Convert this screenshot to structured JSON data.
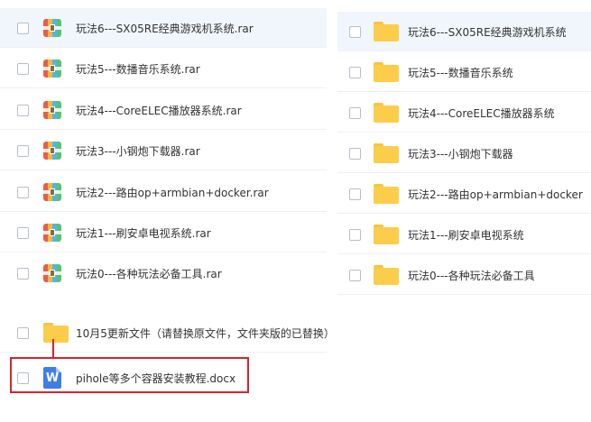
{
  "left_panel": {
    "rows": [
      {
        "name": "玩法6---SX05RE经典游戏机系统.rar",
        "icon": "rar-archive-icon",
        "selected": true
      },
      {
        "name": "玩法5---数播音乐系统.rar",
        "icon": "rar-archive-icon"
      },
      {
        "name": "玩法4---CoreELEC播放器系统.rar",
        "icon": "rar-archive-icon"
      },
      {
        "name": "玩法3---小钢炮下载器.rar",
        "icon": "rar-archive-icon"
      },
      {
        "name": "玩法2---路由op+armbian+docker.rar",
        "icon": "rar-archive-icon"
      },
      {
        "name": "玩法1---刷安卓电视系统.rar",
        "icon": "rar-archive-icon"
      },
      {
        "name": "玩法0---各种玩法必备工具.rar",
        "icon": "rar-archive-icon"
      }
    ],
    "folder_row": {
      "name": "10月5更新文件（请替换原文件，文件夹版的已替换）",
      "icon": "folder-icon"
    },
    "doc_row": {
      "name": "pihole等多个容器安装教程.docx",
      "icon": "word-doc-icon",
      "icon_letter": "W"
    }
  },
  "right_panel": {
    "rows": [
      {
        "name": "玩法6---SX05RE经典游戏机系统",
        "icon": "folder-icon",
        "selected": true
      },
      {
        "name": "玩法5---数播音乐系统",
        "icon": "folder-icon"
      },
      {
        "name": "玩法4---CoreELEC播放器系统",
        "icon": "folder-icon"
      },
      {
        "name": "玩法3---小钢炮下载器",
        "icon": "folder-icon"
      },
      {
        "name": "玩法2---路由op+armbian+docker",
        "icon": "folder-icon"
      },
      {
        "name": "玩法1---刷安卓电视系统",
        "icon": "folder-icon"
      },
      {
        "name": "玩法0---各种玩法必备工具",
        "icon": "folder-icon"
      }
    ]
  },
  "colors": {
    "highlight_box": "#d9232a",
    "selected_row": "#f1f6fd",
    "folder": "#fbcd4a",
    "word_icon": "#3f7ee8"
  }
}
